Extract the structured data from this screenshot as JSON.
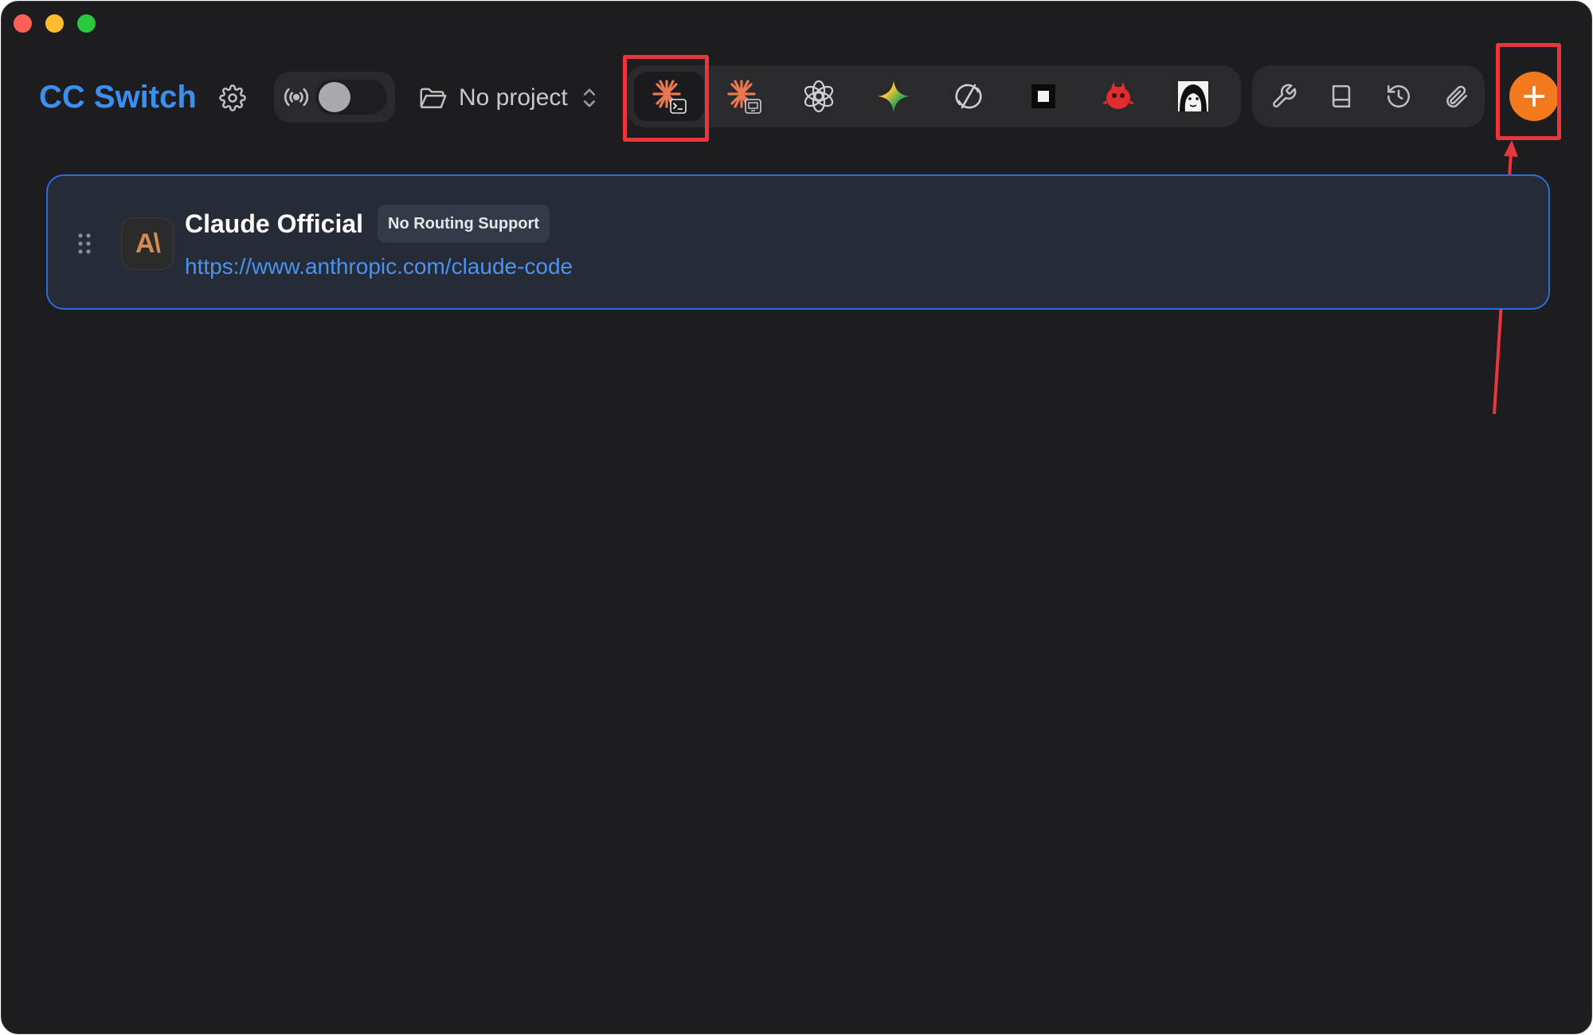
{
  "window": {
    "controls": [
      "close",
      "minimize",
      "maximize"
    ]
  },
  "header": {
    "title": "CC Switch",
    "settings_icon": "gear-icon",
    "proxy": {
      "icon": "broadcast-icon",
      "enabled": false
    },
    "project": {
      "label": "No project",
      "icon": "folder-icon"
    }
  },
  "providers_bar": {
    "items": [
      {
        "name": "claude-code",
        "icon": "claude-code-icon",
        "active": true
      },
      {
        "name": "claude-desktop",
        "icon": "claude-desktop-icon",
        "active": false
      },
      {
        "name": "openai",
        "icon": "openai-icon",
        "active": false
      },
      {
        "name": "gemini",
        "icon": "gemini-icon",
        "active": false
      },
      {
        "name": "sync",
        "icon": "slashed-circle-icon",
        "active": false
      },
      {
        "name": "square",
        "icon": "square-icon",
        "active": false
      },
      {
        "name": "red-bird",
        "icon": "red-bird-icon",
        "active": false
      },
      {
        "name": "avatar",
        "icon": "portrait-icon",
        "active": false
      }
    ]
  },
  "tools_bar": {
    "items": [
      "wrench-icon",
      "book-icon",
      "history-icon",
      "paperclip-icon"
    ]
  },
  "add_button": {
    "icon": "plus-icon"
  },
  "colors": {
    "accent_blue": "#3b8ff0",
    "add_orange": "#f27a1c",
    "highlight_red": "#e8363c",
    "card_border": "#2f6bd8"
  },
  "provider_card": {
    "logo_text": "A\\",
    "name": "Claude Official",
    "badge": "No Routing Support",
    "url": "https://www.anthropic.com/claude-code"
  }
}
